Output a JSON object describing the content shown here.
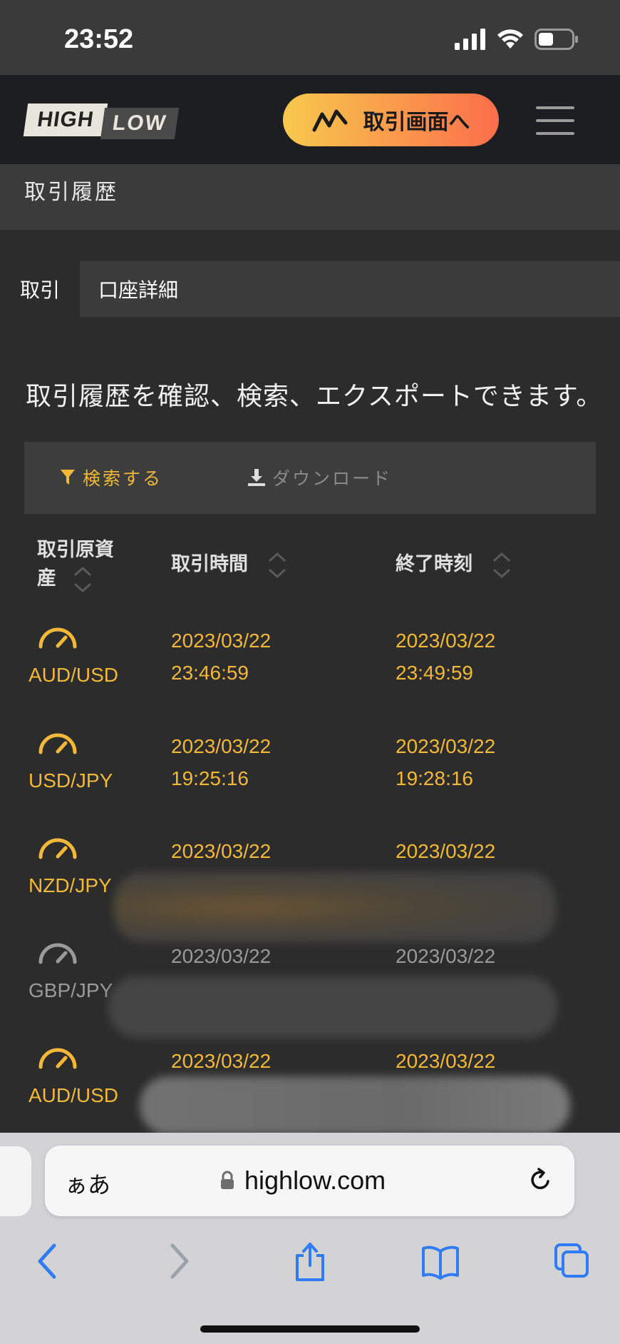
{
  "status_bar": {
    "time": "23:52"
  },
  "header": {
    "logo": {
      "high": "HIGH",
      "low": "LOW"
    },
    "trade_button_label": "取引画面へ"
  },
  "page_title": "取引履歴",
  "tabs": [
    {
      "label": "取引",
      "active": true
    },
    {
      "label": "口座詳細",
      "active": false
    }
  ],
  "intro_text": "取引履歴を確認、検索、エクスポートできます。",
  "toolbar": {
    "search_label": "検索する",
    "download_label": "ダウンロード"
  },
  "table": {
    "columns": [
      "取引原資産",
      "取引時間",
      "終了時刻"
    ],
    "column_first_line1": "取引原資",
    "column_first_line2": "産",
    "rows": [
      {
        "asset": "AUD/USD",
        "trade_date": "2023/03/22",
        "trade_time": "23:46:59",
        "end_date": "2023/03/22",
        "end_time": "23:49:59",
        "color": "#f3b839"
      },
      {
        "asset": "USD/JPY",
        "trade_date": "2023/03/22",
        "trade_time": "19:25:16",
        "end_date": "2023/03/22",
        "end_time": "19:28:16",
        "color": "#f3b839"
      },
      {
        "asset": "NZD/JPY",
        "trade_date": "2023/03/22",
        "trade_time": "",
        "end_date": "2023/03/22",
        "end_time": "",
        "color": "#f3b839"
      },
      {
        "asset": "GBP/JPY",
        "trade_date": "2023/03/22",
        "trade_time": "",
        "end_date": "2023/03/22",
        "end_time": "",
        "color": "#9a9a9a"
      },
      {
        "asset": "AUD/USD",
        "trade_date": "2023/03/22",
        "trade_time": "",
        "end_date": "2023/03/22",
        "end_time": "",
        "color": "#f3b839"
      }
    ]
  },
  "browser": {
    "aa_label": "ぁあ",
    "url": "highlow.com"
  },
  "colors": {
    "accent_gold": "#f3b839",
    "header_bg": "#1d1e21",
    "page_bg": "#2c2c2c",
    "ios_blue": "#2f7cf6"
  }
}
